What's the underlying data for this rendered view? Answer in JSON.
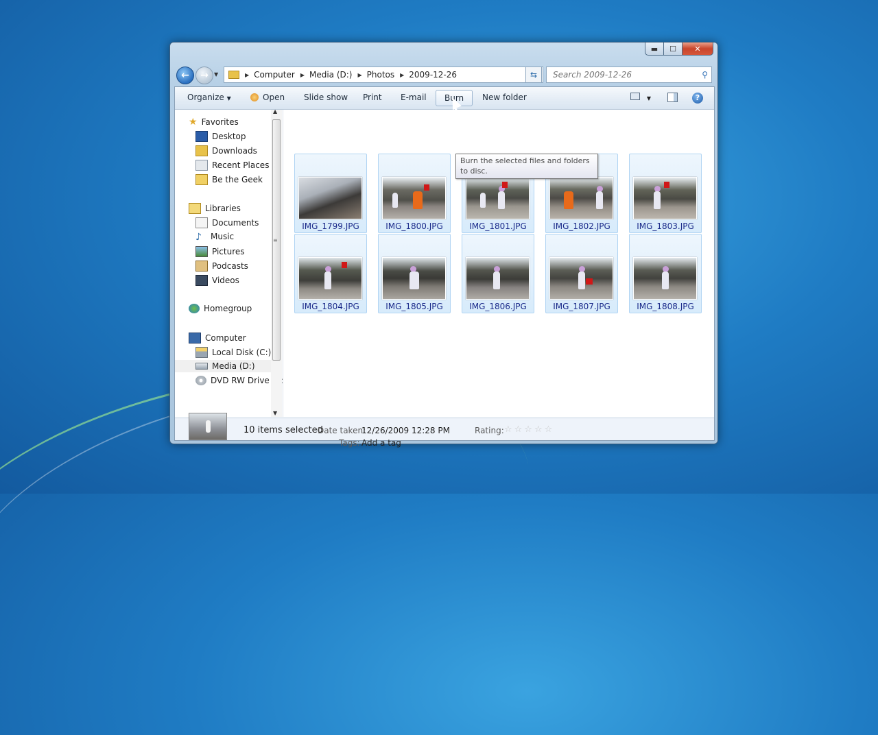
{
  "window": {
    "caption_buttons": {
      "minimize": "▬",
      "maximize": "☐",
      "close": "✕"
    }
  },
  "address_bar": {
    "crumbs": [
      "Computer",
      "Media (D:)",
      "Photos",
      "2009-12-26"
    ]
  },
  "search": {
    "placeholder": "Search 2009-12-26"
  },
  "toolbar": {
    "organize": "Organize",
    "open": "Open",
    "slideshow": "Slide show",
    "print": "Print",
    "email": "E-mail",
    "burn": "Burn",
    "new_folder": "New folder",
    "help": "?"
  },
  "tooltip": "Burn the selected files and folders to disc.",
  "nav": {
    "favorites": "Favorites",
    "favorites_items": [
      "Desktop",
      "Downloads",
      "Recent Places",
      "Be the Geek"
    ],
    "libraries": "Libraries",
    "libraries_items": [
      "Documents",
      "Music",
      "Pictures",
      "Podcasts",
      "Videos"
    ],
    "homegroup": "Homegroup",
    "computer": "Computer",
    "computer_items": [
      "Local Disk (C:)",
      "Media (D:)",
      "DVD RW Drive (E:"
    ]
  },
  "files": [
    "IMG_1799.JPG",
    "IMG_1800.JPG",
    "IMG_1801.JPG",
    "IMG_1802.JPG",
    "IMG_1803.JPG",
    "IMG_1804.JPG",
    "IMG_1805.JPG",
    "IMG_1806.JPG",
    "IMG_1807.JPG",
    "IMG_1808.JPG"
  ],
  "details": {
    "count": "10 items selected",
    "date_label": "Date taken:",
    "date_value": "12/26/2009 12:28 PM",
    "tags_label": "Tags:",
    "tags_value": "Add a tag",
    "rating_label": "Rating:",
    "rating_stars": "☆☆☆☆☆"
  },
  "colors": {
    "accent": "#1b2a8a",
    "selection_fill": "#d7ebfb",
    "selection_border": "#b0d4f3"
  }
}
